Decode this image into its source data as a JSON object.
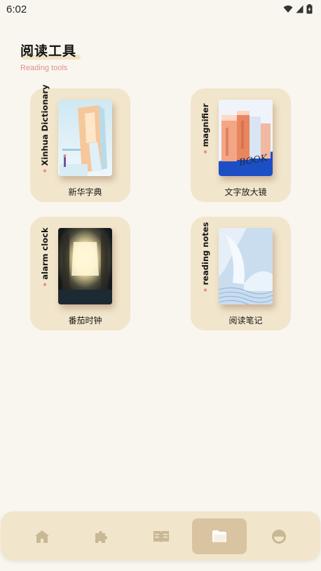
{
  "status_bar": {
    "time": "6:02"
  },
  "header": {
    "title": "阅读工具",
    "subtitle": "Reading tools"
  },
  "tools": [
    {
      "vertical_label": "Xinhua Dictionary",
      "title": "新华字典"
    },
    {
      "vertical_label": "magnifier",
      "title": "文字放大镜"
    },
    {
      "vertical_label": "alarm clock",
      "title": "番茄时钟"
    },
    {
      "vertical_label": "reading notes",
      "title": "阅读笔记"
    }
  ],
  "bottom_nav": {
    "items": [
      "home-icon",
      "puzzle-icon",
      "book-open-icon",
      "folder-icon",
      "face-icon"
    ],
    "active_index": 3
  },
  "colors": {
    "background": "#f9f6ef",
    "card": "#f1e5cb",
    "accent_dot": "#e88a86",
    "subtitle": "#e0908a",
    "nav_active": "#d8c4a1",
    "nav_icon": "#c9b895"
  }
}
